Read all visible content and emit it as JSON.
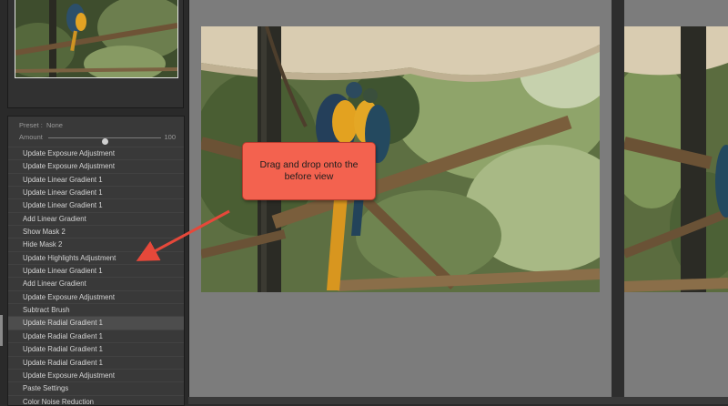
{
  "preset": {
    "label": "Preset :",
    "value": "None"
  },
  "amount": {
    "label": "Amount",
    "value": "100",
    "level": 0.5
  },
  "history": [
    "Update Exposure Adjustment",
    "Update Exposure Adjustment",
    "Update Linear Gradient 1",
    "Update Linear Gradient 1",
    "Update Linear Gradient 1",
    "Add Linear Gradient",
    "Show Mask 2",
    "Hide Mask 2",
    "Update Highlights Adjustment",
    "Update Linear Gradient 1",
    "Add Linear Gradient",
    "Update Exposure Adjustment",
    "Subtract Brush",
    "Update Radial Gradient 1",
    "Update Radial Gradient 1",
    "Update Radial Gradient 1",
    "Update Radial Gradient 1",
    "Update Exposure Adjustment",
    "Paste Settings",
    "Color Noise Reduction"
  ],
  "selected_index": 13,
  "callout": {
    "text": "Drag and drop onto the before view"
  },
  "colors": {
    "callout": "#f3624f",
    "arrow": "#e6483a",
    "panel": "#393939",
    "view_bg": "#7c7c7c"
  }
}
